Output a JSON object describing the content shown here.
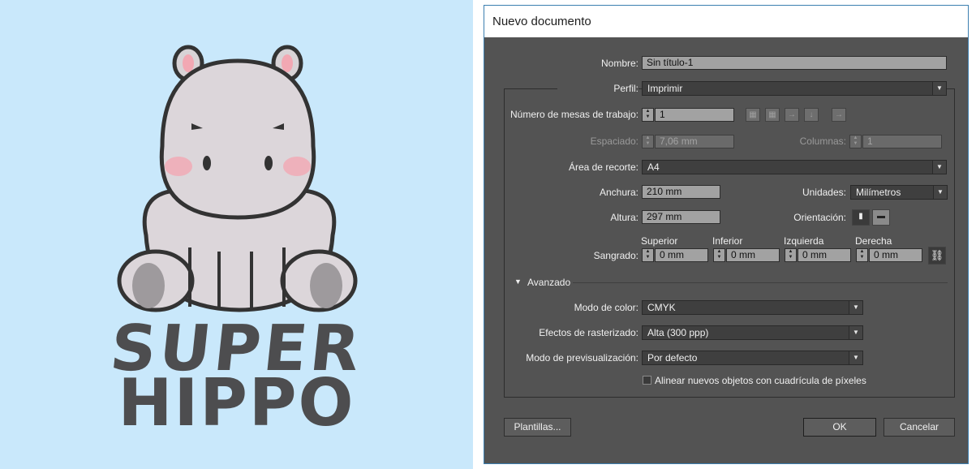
{
  "artwork": {
    "logo_line1": "SUPER",
    "logo_line2": "HIPPO",
    "background_color": "#c9e8fb"
  },
  "dialog": {
    "title": "Nuevo documento",
    "nombre": {
      "label": "Nombre:",
      "value": "Sin título-1"
    },
    "perfil": {
      "label": "Perfil:",
      "value": "Imprimir"
    },
    "mesas": {
      "label": "Número de mesas de trabajo:",
      "value": "1"
    },
    "espaciado": {
      "label": "Espaciado:",
      "value": "7,06 mm"
    },
    "columnas": {
      "label": "Columnas:",
      "value": "1"
    },
    "area": {
      "label": "Área de recorte:",
      "value": "A4"
    },
    "anchura": {
      "label": "Anchura:",
      "value": "210 mm"
    },
    "unidades": {
      "label": "Unidades:",
      "value": "Milímetros"
    },
    "altura": {
      "label": "Altura:",
      "value": "297 mm"
    },
    "orientacion": {
      "label": "Orientación:"
    },
    "sangrado": {
      "label": "Sangrado:",
      "superior": {
        "label": "Superior",
        "value": "0 mm"
      },
      "inferior": {
        "label": "Inferior",
        "value": "0 mm"
      },
      "izquierda": {
        "label": "Izquierda",
        "value": "0 mm"
      },
      "derecha": {
        "label": "Derecha",
        "value": "0 mm"
      }
    },
    "avanzado": {
      "label": "Avanzado"
    },
    "modo_color": {
      "label": "Modo de color:",
      "value": "CMYK"
    },
    "rasterizado": {
      "label": "Efectos de rasterizado:",
      "value": "Alta (300 ppp)"
    },
    "previsualizacion": {
      "label": "Modo de previsualización:",
      "value": "Por defecto"
    },
    "alinear": {
      "label": "Alinear nuevos objetos con cuadrícula de píxeles",
      "checked": false
    },
    "buttons": {
      "plantillas": "Plantillas...",
      "ok": "OK",
      "cancelar": "Cancelar"
    }
  }
}
